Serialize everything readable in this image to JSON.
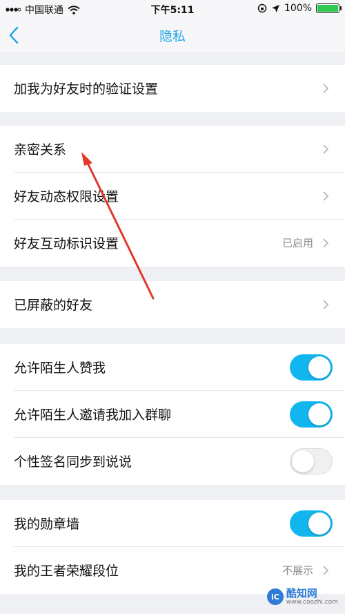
{
  "status_bar": {
    "carrier": "中国联通",
    "time": "下午5:11",
    "battery_percent": "100%",
    "battery_fill": 1.0
  },
  "nav": {
    "title": "隐私",
    "back_icon": "chevron-left-icon"
  },
  "groups": [
    {
      "rows": [
        {
          "label": "加我为好友时的验证设置",
          "type": "link"
        }
      ]
    },
    {
      "rows": [
        {
          "label": "亲密关系",
          "type": "link"
        },
        {
          "label": "好友动态权限设置",
          "type": "link"
        },
        {
          "label": "好友互动标识设置",
          "type": "link",
          "value": "已启用"
        }
      ]
    },
    {
      "rows": [
        {
          "label": "已屏蔽的好友",
          "type": "link"
        }
      ]
    },
    {
      "rows": [
        {
          "label": "允许陌生人赞我",
          "type": "toggle",
          "on": true
        },
        {
          "label": "允许陌生人邀请我加入群聊",
          "type": "toggle",
          "on": true
        },
        {
          "label": "个性签名同步到说说",
          "type": "toggle",
          "on": false
        }
      ]
    },
    {
      "rows": [
        {
          "label": "我的勋章墙",
          "type": "toggle",
          "on": true
        },
        {
          "label": "我的王者荣耀段位",
          "type": "link",
          "value": "不展示"
        }
      ]
    }
  ],
  "watermark": {
    "logo_text": "iC",
    "name": "酷知网",
    "url": "www.coozhi.com"
  },
  "colors": {
    "accent": "#22a8e8",
    "toggle_on": "#11b6ef",
    "annotation_arrow": "#e0392b"
  }
}
